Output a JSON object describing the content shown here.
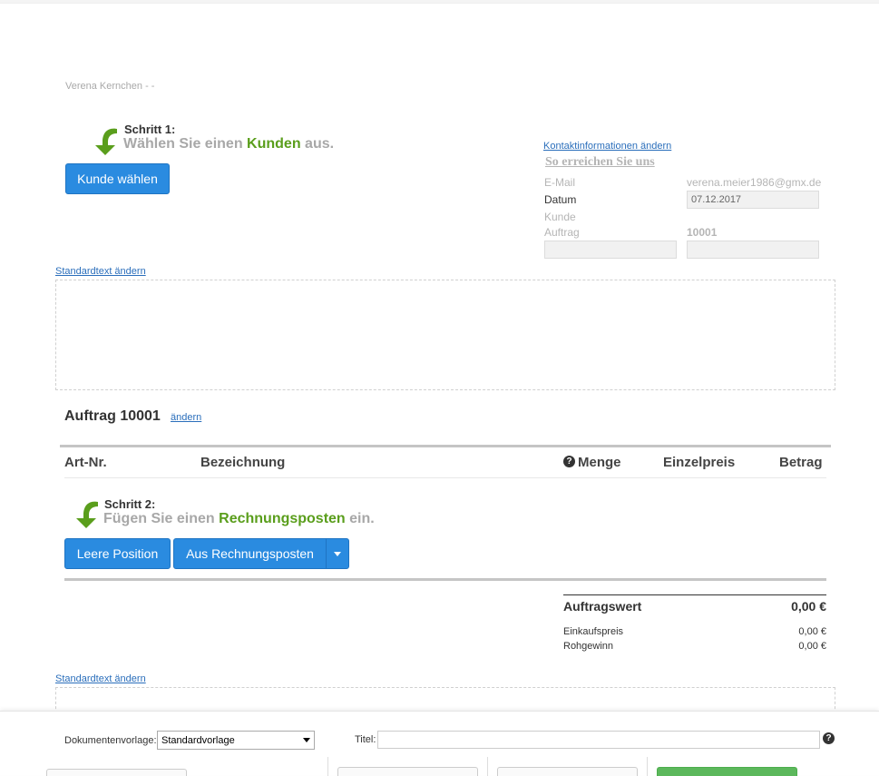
{
  "sender": {
    "line": "Verena Kernchen - -"
  },
  "step1": {
    "title": "Schritt 1:",
    "text_before": "Wählen Sie einen",
    "text_highlight": "Kunden",
    "text_after": "aus.",
    "button": "Kunde wählen"
  },
  "contact": {
    "edit_link": "Kontaktinformationen ändern",
    "heading": "So erreichen Sie uns",
    "email_label": "E-Mail",
    "email_value": "verena.meier1986@gmx.de",
    "date_label": "Datum",
    "date_value": "07.12.2017",
    "customer_label": "Kunde",
    "order_label": "Auftrag",
    "order_value": "10001"
  },
  "header_text": {
    "edit_link": "Standardtext ändern"
  },
  "order": {
    "title": "Auftrag 10001",
    "edit_link": "ändern",
    "columns": {
      "art_nr": "Art-Nr.",
      "bezeichnung": "Bezeichnung",
      "menge": "Menge",
      "einzelpreis": "Einzelpreis",
      "betrag": "Betrag"
    }
  },
  "step2": {
    "title": "Schritt 2:",
    "text_before": "Fügen Sie einen",
    "text_highlight": "Rechnungsposten",
    "text_after": "ein.",
    "button_empty": "Leere Position",
    "button_from": "Aus Rechnungsposten"
  },
  "totals": {
    "value_label": "Auftragswert",
    "value": "0,00 €",
    "purchase_label": "Einkaufspreis",
    "purchase": "0,00 €",
    "profit_label": "Rohgewinn",
    "profit": "0,00 €"
  },
  "footer_text": {
    "edit_link": "Standardtext ändern"
  },
  "footer": {
    "template_label": "Dokumentenvorlage:",
    "template_value": "Standardvorlage",
    "title_label": "Titel:",
    "title_value": ""
  },
  "colors": {
    "accent_blue": "#2a8be0",
    "highlight_green": "#5a9e1c",
    "save_green": "#5cb85c"
  }
}
